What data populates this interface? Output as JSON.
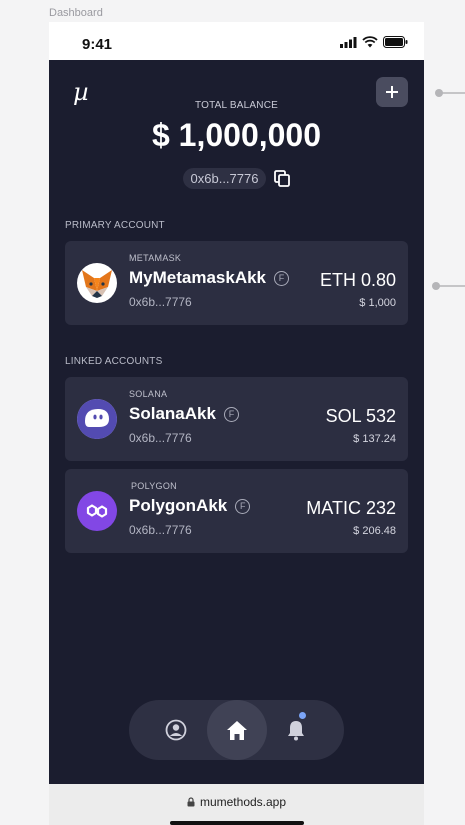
{
  "frame": {
    "label": "Dashboard"
  },
  "status_bar": {
    "time": "9:41"
  },
  "header": {
    "logo": "µ",
    "add_button": "+"
  },
  "balance": {
    "label": "TOTAL BALANCE",
    "value": "$ 1,000,000",
    "address": "0x6b...7776"
  },
  "primary": {
    "section_label": "PRIMARY ACCOUNT",
    "account": {
      "provider": "METAMASK",
      "name": "MyMetamaskAkk",
      "badge": "F",
      "address": "0x6b...7776",
      "amount": "ETH 0.80",
      "usd": "$ 1,000",
      "icon": "metamask-fox-icon"
    }
  },
  "linked": {
    "section_label": "LINKED ACCOUNTS",
    "accounts": [
      {
        "provider": "SOLANA",
        "name": "SolanaAkk",
        "badge": "F",
        "address": "0x6b...7776",
        "amount": "SOL 532",
        "usd": "$ 137.24",
        "icon": "solana-ghost-icon"
      },
      {
        "provider": "POLYGON",
        "name": "PolygonAkk",
        "badge": "F",
        "address": "0x6b...7776",
        "amount": "MATIC 232",
        "usd": "$ 206.48",
        "icon": "polygon-icon"
      }
    ]
  },
  "nav": {
    "items": [
      "profile-icon",
      "home-icon",
      "bell-icon"
    ],
    "active": "home-icon"
  },
  "browser": {
    "url": "mumethods.app"
  },
  "colors": {
    "background": "#1b1d2f",
    "card": "#2c2e41",
    "accent": "#7ba4f7"
  }
}
